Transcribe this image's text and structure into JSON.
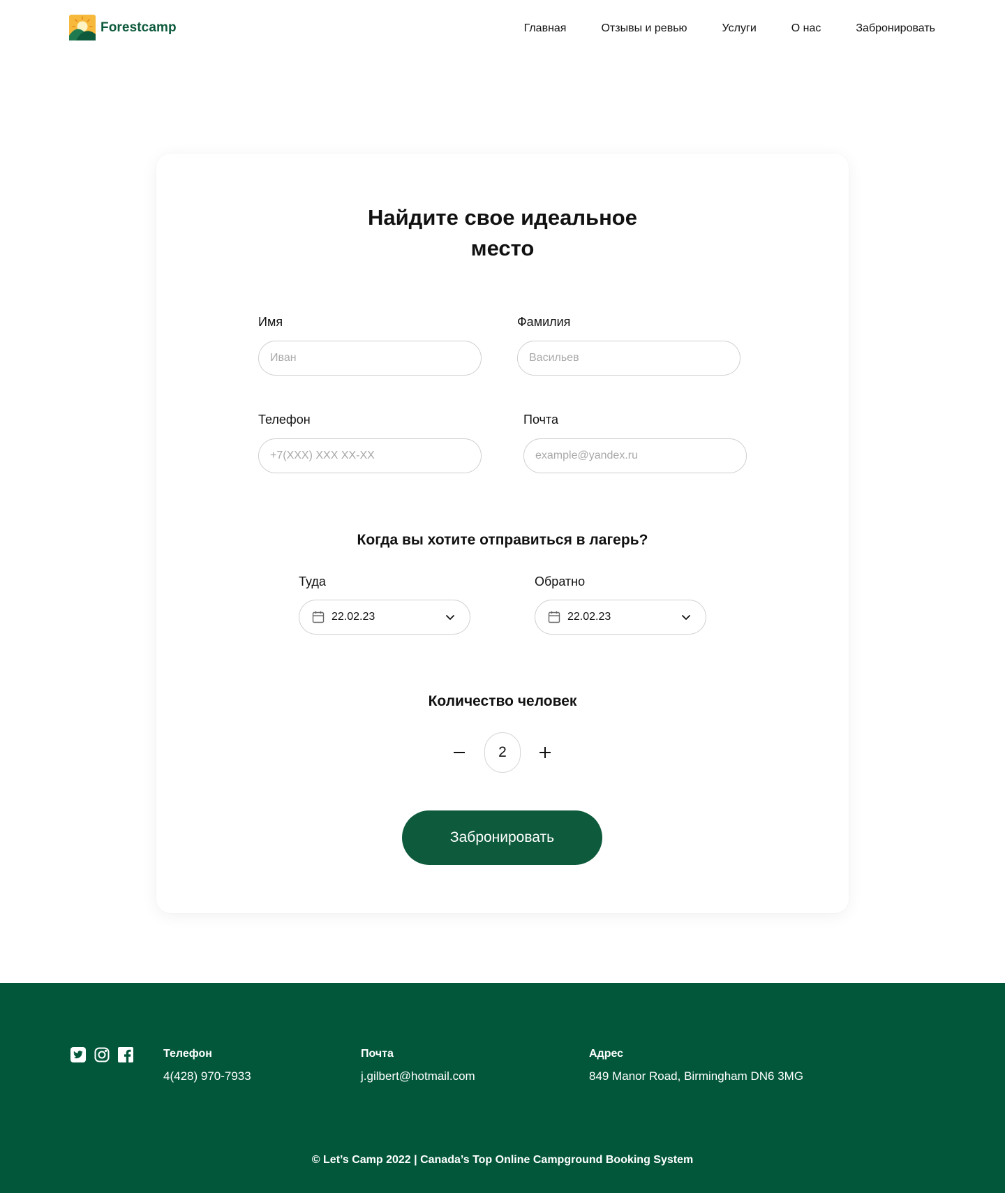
{
  "brand": {
    "name": "Forestcamp",
    "logo_icon": "sun-mountain-logo-icon",
    "color": "#0e5a3c"
  },
  "nav": {
    "items": [
      "Главная",
      "Отзывы и ревью",
      "Услуги",
      "О нас",
      "Забронировать"
    ]
  },
  "form": {
    "title": "Найдите свое идеальное место",
    "first_name": {
      "label": "Имя",
      "placeholder": "Иван"
    },
    "last_name": {
      "label": "Фамилия",
      "placeholder": "Васильев"
    },
    "phone": {
      "label": "Телефон",
      "placeholder": "+7(XXX) XXX XX-XX"
    },
    "email": {
      "label": "Почта",
      "placeholder": "example@yandex.ru"
    },
    "dates_heading": "Когда вы хотите отправиться в лагерь?",
    "depart": {
      "label": "Туда",
      "value": "22.02.23",
      "icon": "calendar-icon"
    },
    "return": {
      "label": "Обратно",
      "value": "22.02.23",
      "icon": "calendar-icon"
    },
    "guests_heading": "Количество человек",
    "guests": {
      "value": "2",
      "decrement_icon": "minus-icon",
      "increment_icon": "plus-icon"
    },
    "submit_label": "Забронировать"
  },
  "footer": {
    "background": "#02573b",
    "social": [
      "twitter-icon",
      "instagram-icon",
      "facebook-icon"
    ],
    "phone": {
      "title": "Телефон",
      "value": "4(428) 970-7933"
    },
    "email": {
      "title": "Почта",
      "value": "j.gilbert@hotmail.com"
    },
    "address": {
      "title": "Адрес",
      "value": "849 Manor Road, Birmingham DN6 3MG"
    },
    "copyright": "© Let’s Camp 2022 | Canada’s Top Online Campground Booking System"
  }
}
